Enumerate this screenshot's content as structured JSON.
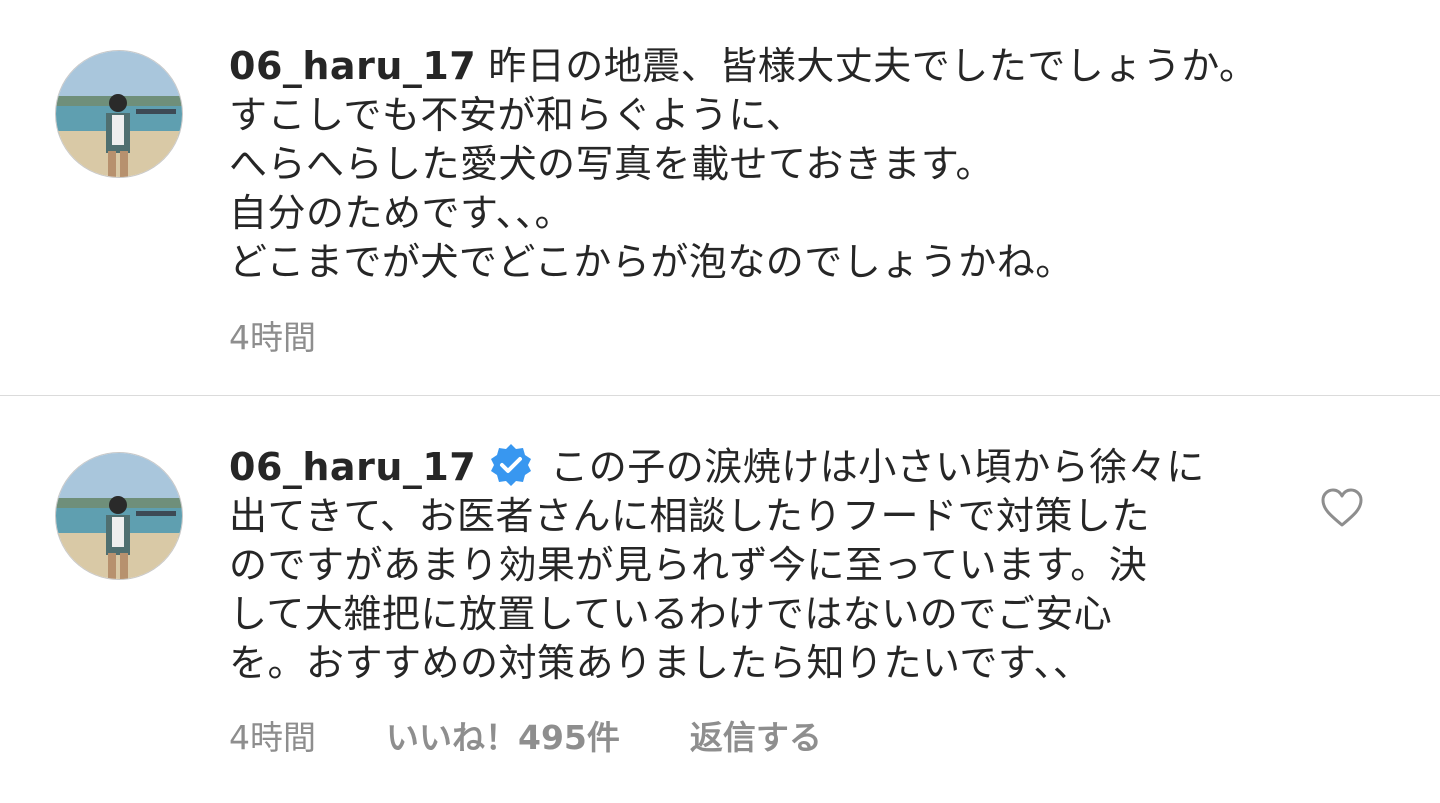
{
  "comments": [
    {
      "username": "06_haru_17",
      "verified": false,
      "lines": [
        "昨日の地震、皆様大丈夫でしたでしょうか。",
        "すこしでも不安が和らぐように、",
        "へらへらした愛犬の写真を載せておきます。",
        "自分のためです、、。",
        "どこまでが犬でどこからが泡なのでしょうかね。"
      ],
      "time": "4時間"
    },
    {
      "username": "06_haru_17",
      "verified": true,
      "lines": [
        "この子の涙焼けは小さい頃から徐々に",
        "出てきて、お医者さんに相談したりフードで対策した",
        "のですがあまり効果が見られず今に至っています。決",
        "して大雑把に放置しているわけではないのでご安心",
        "を。おすすめの対策ありましたら知りたいです、、"
      ],
      "time": "4時間",
      "likes": "いいね！495件",
      "reply": "返信する"
    }
  ],
  "icons": {
    "verified": "verified-badge-icon",
    "like": "heart-outline-icon"
  },
  "colors": {
    "text": "#262626",
    "meta": "#8e8e8e",
    "verified": "#3897f0",
    "divider": "#dbdbdb"
  }
}
